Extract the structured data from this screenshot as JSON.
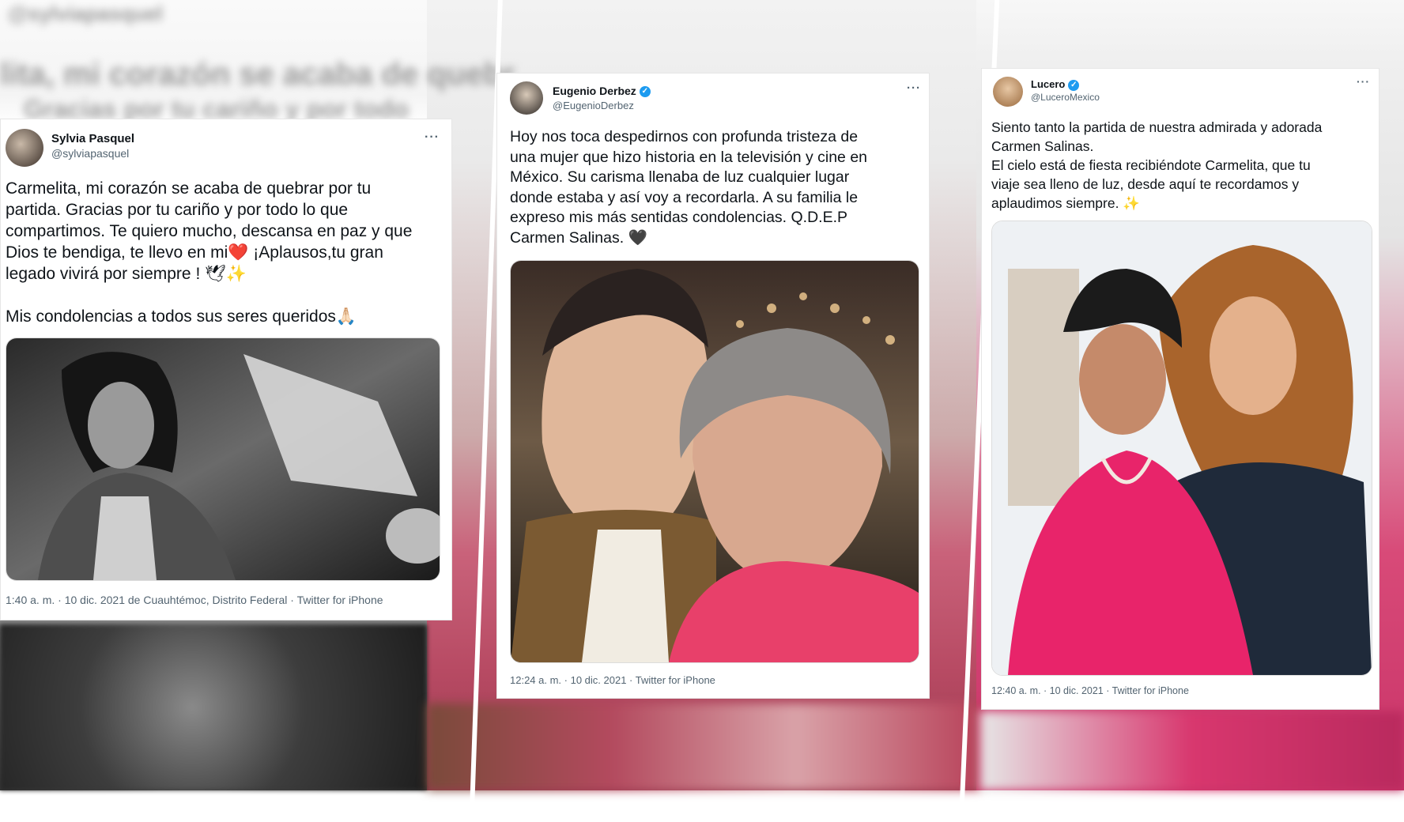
{
  "background": {
    "blur_left_lines": [
      "@sylviapasquel",
      "lita, mi corazón se acaba de quebr",
      "Gracias por tu cariño y por todo"
    ],
    "blur_mid_lines": [
      "",
      ""
    ]
  },
  "tweets": [
    {
      "name": "Sylvia Pasquel",
      "handle": "@sylviapasquel",
      "more": "···",
      "text": "Carmelita, mi corazón se acaba de quebrar por tu\npartida. Gracias por tu cariño y por todo lo que\ncompartimos. Te quiero mucho, descansa en paz y que\nDios te bendiga, te llevo en mi❤️ ¡Aplausos,tu gran\nlegado vivirá por siempre ! 🕊✨\n\nMis condolencias a todos sus seres queridos🙏🏻",
      "meta": "1:40 a. m. · 10 dic. 2021 de Cuauhtémoc, Distrito Federal · Twitter for iPhone",
      "verified": false
    },
    {
      "name": "Eugenio Derbez",
      "handle": "@EugenioDerbez",
      "more": "···",
      "text": "Hoy nos toca despedirnos con profunda tristeza de\nuna mujer que hizo historia en la televisión y cine en\nMéxico. Su carisma llenaba de luz cualquier lugar\ndonde estaba y así voy a recordarla. A su familia le\nexpreso mis más sentidas condolencias. Q.D.E.P\nCarmen Salinas. 🖤",
      "meta": "12:24 a. m. · 10 dic. 2021 · Twitter for iPhone",
      "verified": true
    },
    {
      "name": "Lucero",
      "handle": "@LuceroMexico",
      "more": "···",
      "text": "Siento tanto la partida de nuestra admirada y adorada\nCarmen Salinas.\nEl cielo está de fiesta recibiéndote Carmelita, que tu\nviaje sea lleno de luz, desde aquí te recordamos y\naplaudimos siempre. ✨",
      "meta": "12:40 a. m. · 10 dic. 2021 · Twitter for iPhone",
      "verified": true
    }
  ],
  "icons": {
    "verified": "verified-badge-icon",
    "more": "more-options-icon"
  },
  "colors": {
    "text": "#0f1419",
    "secondary": "#536471",
    "verified": "#1d9bf0"
  }
}
